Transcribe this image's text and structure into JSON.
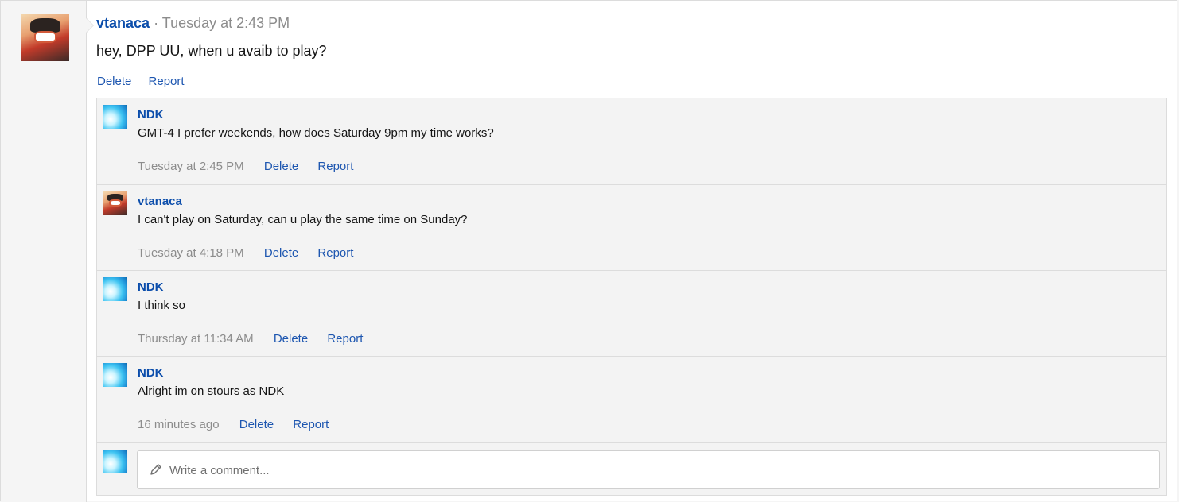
{
  "post": {
    "username": "vtanaca",
    "separator": "·",
    "time": "Tuesday at 2:43 PM",
    "body": "hey, DPP UU, when u avaib to play?",
    "actions": {
      "delete": "Delete",
      "report": "Report"
    }
  },
  "comments": [
    {
      "username": "NDK",
      "avatar": "ndk-avatar",
      "text": "GMT-4 I prefer weekends, how does Saturday 9pm my time works?",
      "time": "Tuesday at 2:45 PM",
      "delete": "Delete",
      "report": "Report"
    },
    {
      "username": "vtanaca",
      "avatar": "vtanaca-avatar",
      "text": "I can't play on Saturday, can u play the same time on Sunday?",
      "time": "Tuesday at 4:18 PM",
      "delete": "Delete",
      "report": "Report"
    },
    {
      "username": "NDK",
      "avatar": "ndk-avatar",
      "text": "I think so",
      "time": "Thursday at 11:34 AM",
      "delete": "Delete",
      "report": "Report"
    },
    {
      "username": "NDK",
      "avatar": "ndk-avatar",
      "text": "Alright im on stours as NDK",
      "time": "16 minutes ago",
      "delete": "Delete",
      "report": "Report"
    }
  ],
  "comment_box": {
    "placeholder": "Write a comment...",
    "icon": "pencil-icon"
  },
  "colors": {
    "link": "#1d56b0",
    "username": "#0b4dab",
    "muted": "#8c8c8c",
    "comment_bg": "#f3f3f3"
  }
}
